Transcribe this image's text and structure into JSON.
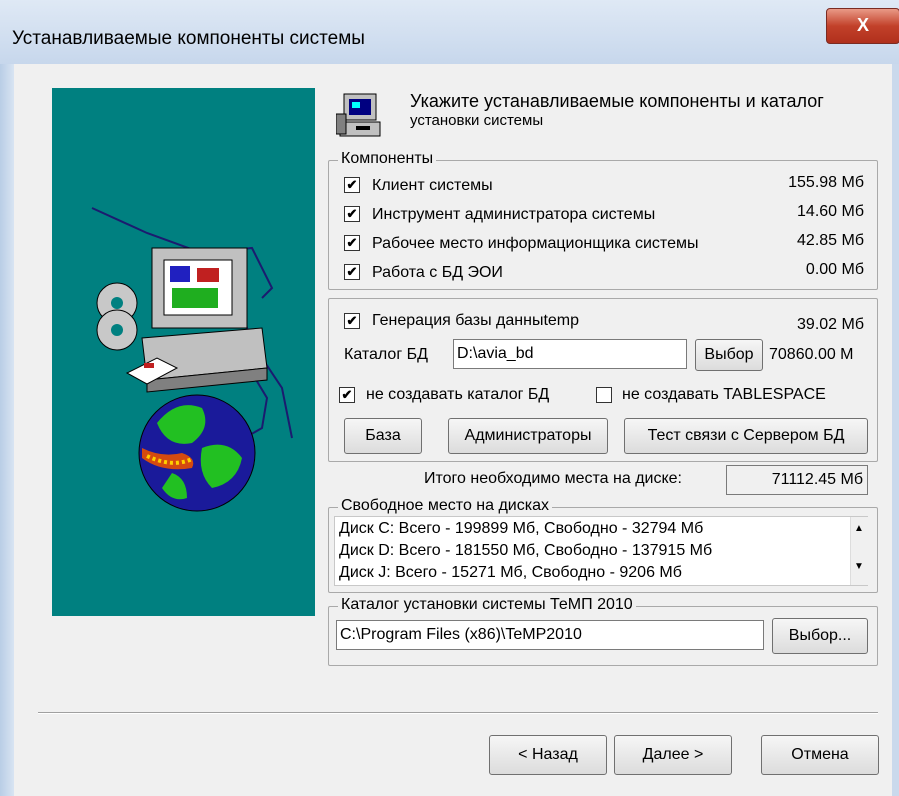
{
  "window": {
    "title": "Устанавливаемые компоненты системы",
    "close_label": "X"
  },
  "header": {
    "line1": "Укажите устанавливаемые компоненты и каталог",
    "line2": "установки системы"
  },
  "components": {
    "title": "Компоненты",
    "items": [
      {
        "label": "Клиент системы",
        "size": "155.98 Мб",
        "checked": "✔"
      },
      {
        "label": "Инструмент администратора системы",
        "size": "14.60 Мб",
        "checked": "✔"
      },
      {
        "label": "Рабочее место информационщика системы",
        "size": "42.85 Мб",
        "checked": "✔"
      },
      {
        "label": "Работа с БД ЭОИ",
        "size": "0.00 Мб",
        "checked": "✔"
      }
    ]
  },
  "db": {
    "gen_label": "Генерация базы данныtemp",
    "gen_checked": "✔",
    "gen_size": "39.02 Мб",
    "catalog_label": "Каталог БД",
    "catalog_value": "D:\\avia_bd",
    "choose_label": "Выбор",
    "catalog_size": "70860.00 М",
    "no_create_catalog_label": "не создавать каталог БД",
    "no_create_catalog_checked": "✔",
    "no_create_tablespace_label": "не создавать TABLESPACE",
    "no_create_tablespace_checked": "",
    "buttons": {
      "base": "База",
      "admins": "Администраторы",
      "test": "Тест связи с Сервером БД"
    }
  },
  "total": {
    "label": "Итого необходимо места на диске:",
    "value": "71112.45 Мб"
  },
  "free_space": {
    "title": "Свободное место на дисках",
    "lines": [
      "Диск C:   Всего - 199899 Мб, Свободно - 32794 Мб",
      "Диск D:   Всего - 181550 Мб, Свободно - 137915 Мб",
      "Диск J:   Всего - 15271 Мб, Свободно - 9206 Мб"
    ],
    "scroll_up": "▲",
    "scroll_down": "▼"
  },
  "install_dir": {
    "title": "Каталог установки системы ТеМП 2010",
    "value": "C:\\Program Files (x86)\\TeMP2010",
    "choose_label": "Выбор..."
  },
  "footer": {
    "back": "< Назад",
    "next": "Далее >",
    "cancel": "Отмена"
  },
  "colors": {
    "art_bg": "#008080",
    "close_btn": "#c2412a"
  }
}
